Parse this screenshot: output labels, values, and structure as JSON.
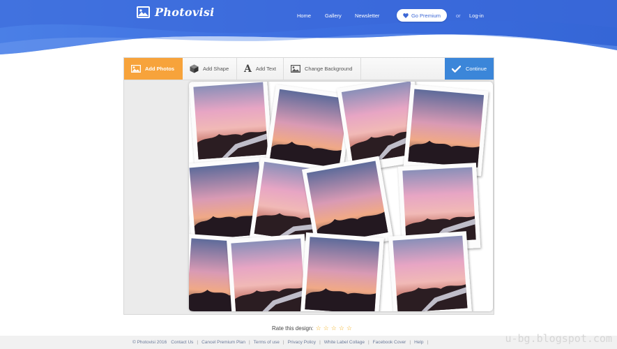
{
  "header": {
    "logo_text": "Photovisi",
    "nav": [
      "Home",
      "Gallery",
      "Newsletter"
    ],
    "premium_label": "Go Premium",
    "or_text": "or",
    "login_label": "Log-in"
  },
  "toolbar": {
    "add_photos": "Add Photos",
    "add_shape": "Add Shape",
    "add_text": "Add Text",
    "change_background": "Change Background",
    "continue": "Continue"
  },
  "rating": {
    "label": "Rate this design:",
    "stars": 5
  },
  "footer": {
    "copyright": "© Photovisi 2016",
    "links": [
      "Contact Us",
      "Cancel Premium Plan",
      "Terms of use",
      "Privacy Policy",
      "White Label Collage",
      "Facebook Cover",
      "Help"
    ]
  },
  "watermark": "u-bg.blogspot.com",
  "colors": {
    "header_blue": "#3d6ee0",
    "accent_orange": "#f7a33b",
    "continue_blue": "#3b86d9"
  },
  "icons": [
    "image-icon",
    "cube-icon",
    "text-a-icon",
    "background-image-icon",
    "checkmark-icon",
    "heart-icon",
    "star-icon"
  ]
}
